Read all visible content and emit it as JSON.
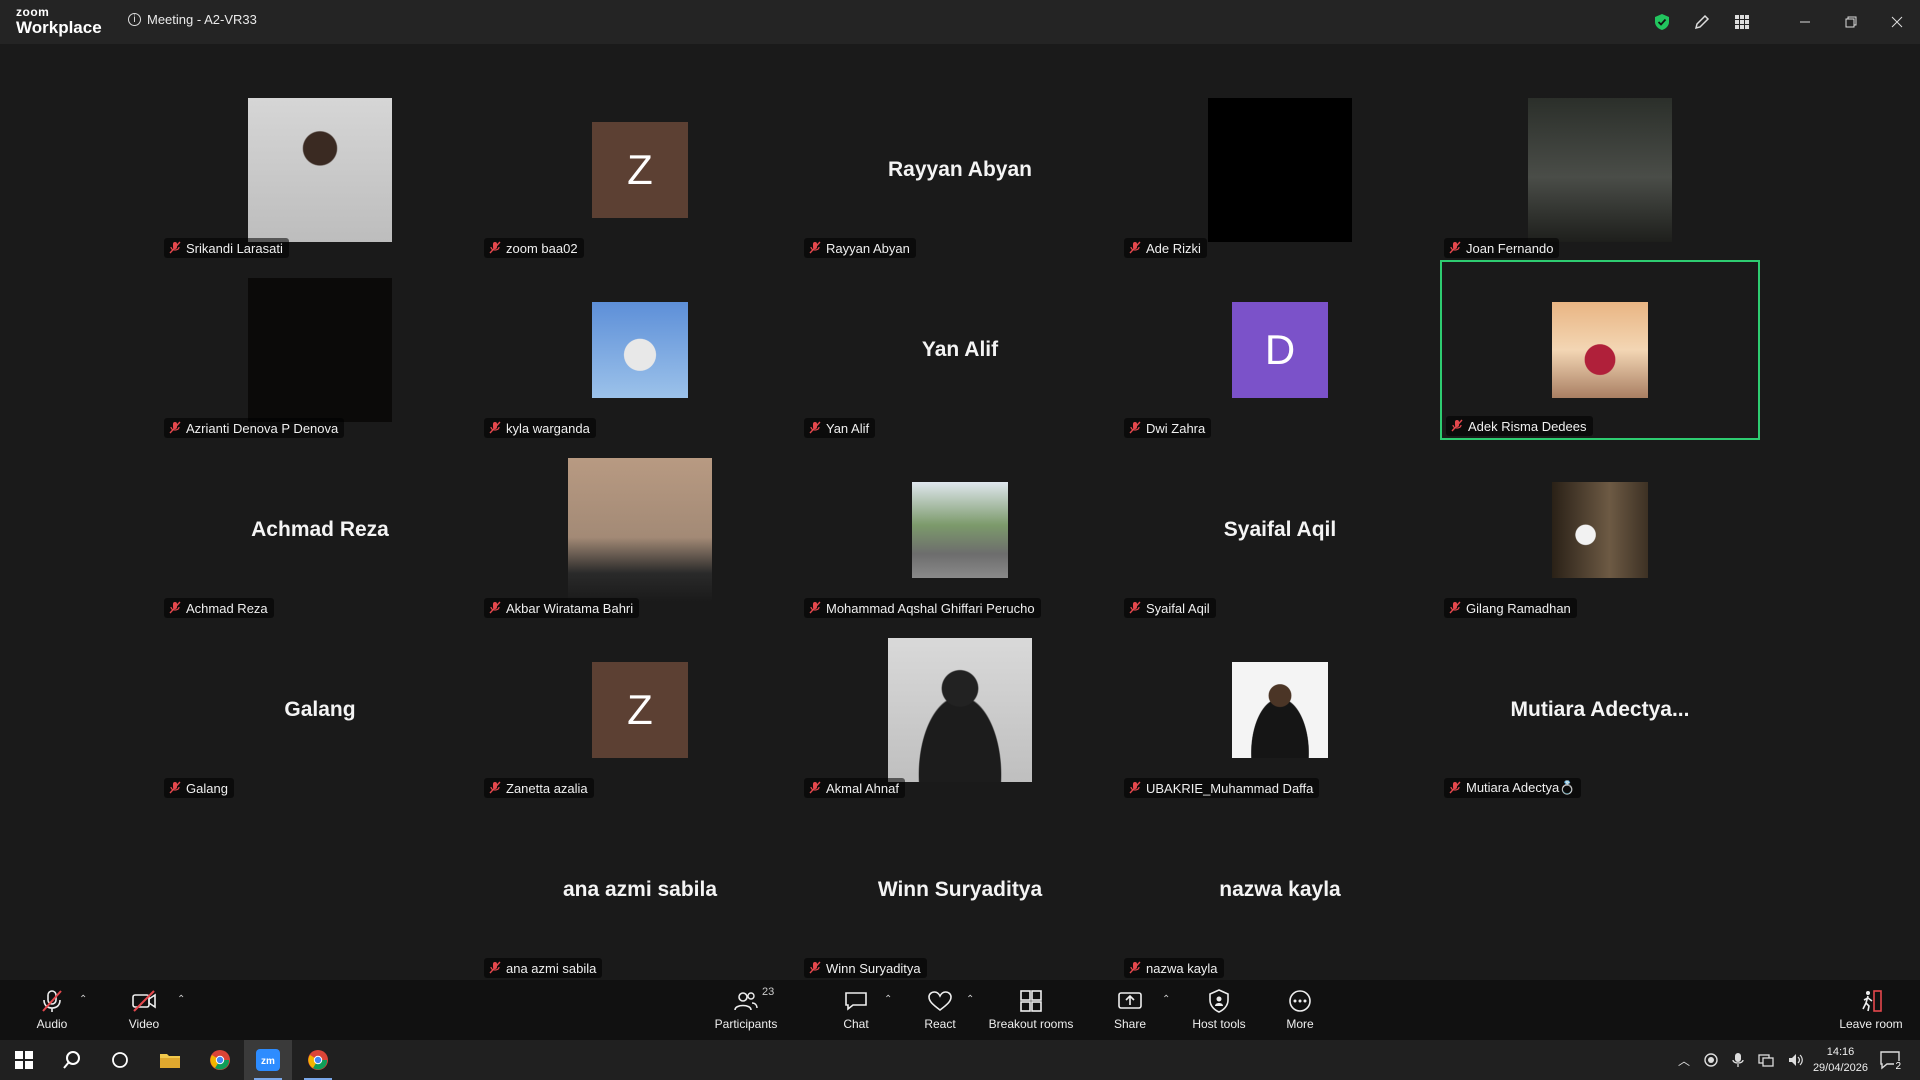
{
  "titlebar": {
    "brand_top": "zoom",
    "brand_bottom": "Workplace",
    "meeting_title": "Meeting - A2-VR33"
  },
  "participants": [
    {
      "name": "Srikandi Larasati",
      "display": "photo",
      "photo_style": "portrait-grey",
      "size": "big"
    },
    {
      "name": "zoom baa02",
      "display": "initial",
      "initial": "Z",
      "color": "#5c4033",
      "size": "small"
    },
    {
      "name": "Rayyan Abyan",
      "display": "name",
      "big_name": "Rayyan Abyan"
    },
    {
      "name": "Ade Rizki",
      "display": "photo",
      "photo_style": "black",
      "size": "big"
    },
    {
      "name": "Joan Fernando",
      "display": "photo",
      "photo_style": "outdoor-dark",
      "size": "big"
    },
    {
      "name": "Azrianti Denova P Denova",
      "display": "photo",
      "photo_style": "near-black",
      "size": "big"
    },
    {
      "name": "kyla warganda",
      "display": "photo",
      "photo_style": "sky-blue",
      "size": "small"
    },
    {
      "name": "Yan Alif",
      "display": "name",
      "big_name": "Yan Alif"
    },
    {
      "name": "Dwi Zahra",
      "display": "initial",
      "initial": "D",
      "color": "#7b52c9",
      "size": "small"
    },
    {
      "name": "Adek Risma Dedees",
      "display": "photo",
      "photo_style": "sunset",
      "size": "small",
      "active": true
    },
    {
      "name": "Achmad Reza",
      "display": "name",
      "big_name": "Achmad Reza"
    },
    {
      "name": "Akbar Wiratama Bahri",
      "display": "photo",
      "photo_style": "city-dusk",
      "size": "big"
    },
    {
      "name": "Mohammad Aqshal Ghiffari Perucho",
      "display": "photo",
      "photo_style": "street-green",
      "size": "small"
    },
    {
      "name": "Syaifal Aqil",
      "display": "name",
      "big_name": "Syaifal Aqil"
    },
    {
      "name": "Gilang Ramadhan",
      "display": "photo",
      "photo_style": "door-brown",
      "size": "small"
    },
    {
      "name": "Galang",
      "display": "name",
      "big_name": "Galang"
    },
    {
      "name": "Zanetta azalia",
      "display": "initial",
      "initial": "Z",
      "color": "#5c4033",
      "size": "small"
    },
    {
      "name": "Akmal Ahnaf",
      "display": "photo",
      "photo_style": "bw-portrait",
      "size": "big"
    },
    {
      "name": "UBAKRIE_Muhammad Daffa",
      "display": "photo",
      "photo_style": "white-bg",
      "size": "small"
    },
    {
      "name": "Mutiara Adectya💍",
      "display": "name",
      "big_name": "Mutiara  Adectya..."
    },
    {
      "name": "ana azmi sabila",
      "display": "name",
      "big_name": "ana azmi sabila"
    },
    {
      "name": "Winn Suryaditya",
      "display": "name",
      "big_name": "Winn Suryaditya"
    },
    {
      "name": "nazwa kayla",
      "display": "name",
      "big_name": "nazwa kayla"
    }
  ],
  "controls": {
    "audio": "Audio",
    "video": "Video",
    "participants": "Participants",
    "participants_count": "23",
    "chat": "Chat",
    "react": "React",
    "breakout": "Breakout rooms",
    "share": "Share",
    "host_tools": "Host tools",
    "more": "More",
    "leave": "Leave room"
  },
  "taskbar": {
    "time": "14:16",
    "date": "29/04/2026",
    "notifications": "2"
  },
  "colors": {
    "active_speaker": "#2ecc71",
    "muted": "#e5484d",
    "shield": "#22c55e"
  }
}
